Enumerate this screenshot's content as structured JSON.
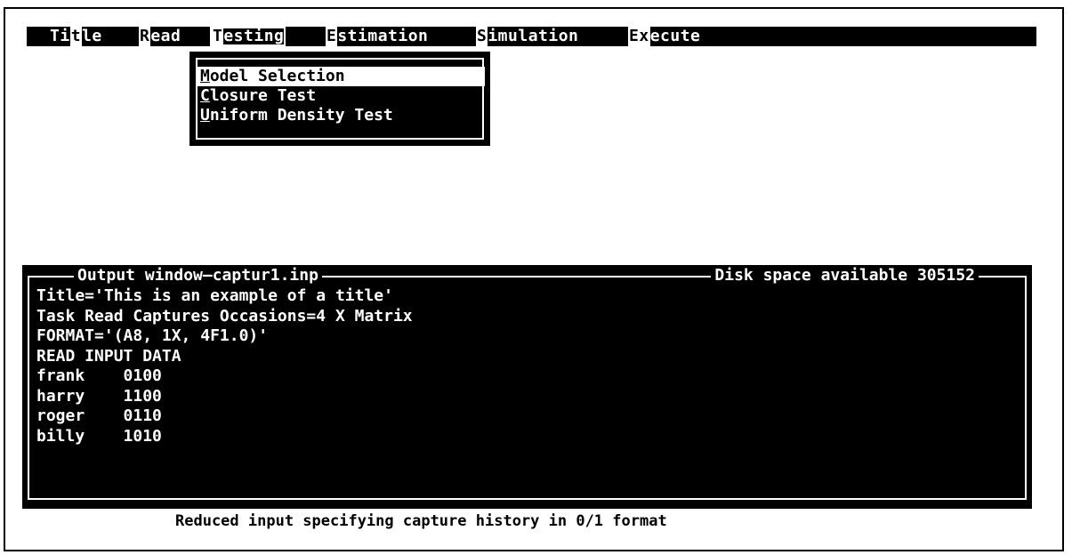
{
  "menubar": {
    "items": [
      {
        "pre": "Ti",
        "hotkey": "t",
        "post": "le"
      },
      {
        "pre": "",
        "hotkey": "R",
        "post": "ead"
      },
      {
        "pre": "",
        "hotkey": "T",
        "post": "esting"
      },
      {
        "pre": "",
        "hotkey": "E",
        "post": "stimation"
      },
      {
        "pre": "",
        "hotkey": "S",
        "post": "imulation"
      },
      {
        "pre": "",
        "hotkey": "Ex",
        "post": "ecute"
      }
    ]
  },
  "dropdown": {
    "items": [
      {
        "hotkey": "M",
        "rest": "odel Selection"
      },
      {
        "hotkey": "C",
        "rest": "losure Test"
      },
      {
        "hotkey": "U",
        "rest": "niform Density Test"
      }
    ]
  },
  "output": {
    "title": "Output window—captur1.inp",
    "disk": "Disk space available 305152",
    "lines": [
      "Title='This is an example of a title'",
      "Task Read Captures Occasions=4 X Matrix",
      "FORMAT='(A8, 1X, 4F1.0)'",
      "READ INPUT DATA",
      "frank    0100",
      "harry    1100",
      "roger    0110",
      "billy    1010"
    ]
  },
  "status": "Reduced input specifying capture history in 0/1 format"
}
